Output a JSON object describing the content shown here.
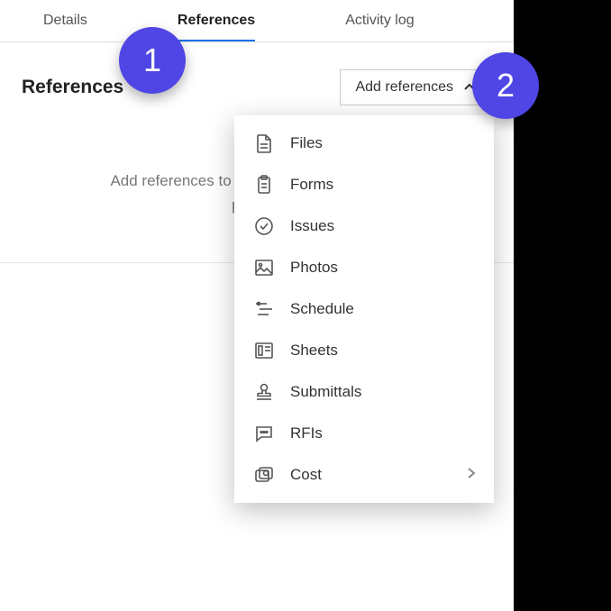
{
  "tabs": {
    "details": "Details",
    "references": "References",
    "activity_log": "Activity log"
  },
  "section": {
    "title": "References",
    "add_button": "Add references",
    "empty_line1": "Add references to related documents in the",
    "empty_line2": "project."
  },
  "dropdown": {
    "files": "Files",
    "forms": "Forms",
    "issues": "Issues",
    "photos": "Photos",
    "schedule": "Schedule",
    "sheets": "Sheets",
    "submittals": "Submittals",
    "rfis": "RFIs",
    "cost": "Cost"
  },
  "markers": {
    "one": "1",
    "two": "2"
  }
}
